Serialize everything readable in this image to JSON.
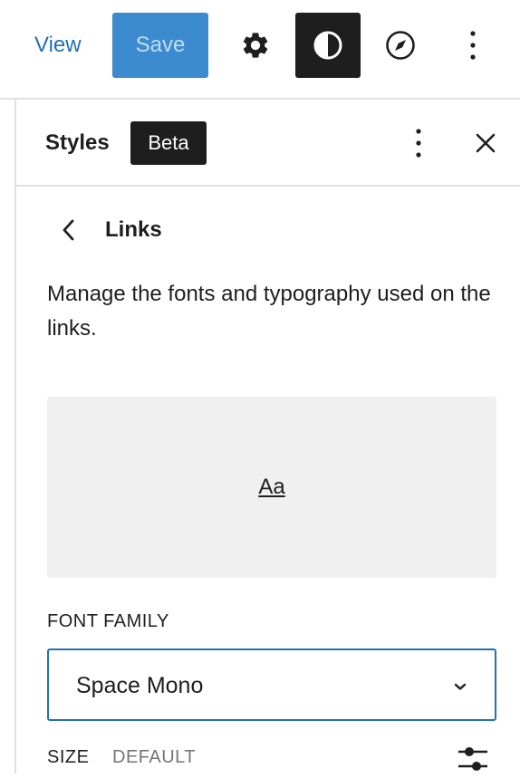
{
  "toolbar": {
    "view_label": "View",
    "save_label": "Save",
    "icons": {
      "settings": "gear-icon",
      "styles": "half-circle-contrast-icon",
      "browse": "compass-icon",
      "more": "vertical-ellipsis-icon"
    },
    "colors": {
      "link": "#2271b1",
      "save_bg": "#3d8bcf",
      "styles_active_bg": "#1e1e1e"
    }
  },
  "panel": {
    "title": "Styles",
    "badge": "Beta",
    "more_icon": "vertical-ellipsis-icon",
    "close_icon": "close-icon"
  },
  "nav": {
    "back_icon": "chevron-left-icon",
    "title": "Links"
  },
  "description": "Manage the fonts and typography used on the links.",
  "preview": {
    "text": "Aa"
  },
  "font_family": {
    "label": "FONT FAMILY",
    "selected": "Space Mono"
  },
  "size": {
    "label": "SIZE",
    "value": "DEFAULT",
    "options_icon": "sliders-icon"
  }
}
